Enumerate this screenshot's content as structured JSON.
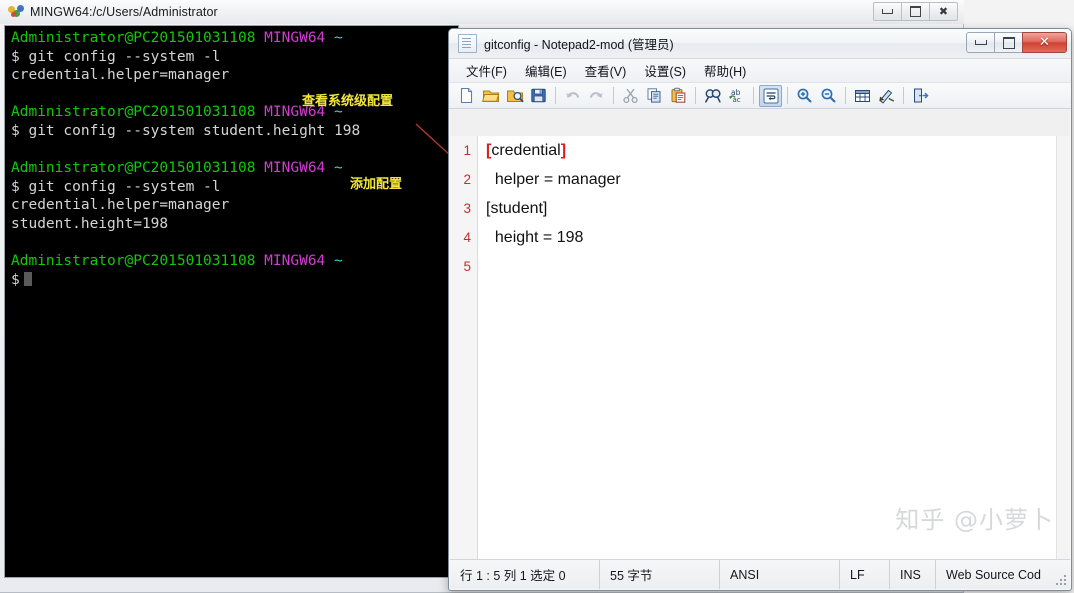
{
  "terminal": {
    "window_title": "MINGW64:/c/Users/Administrator",
    "icon": "mingw-bash-icon",
    "buttons": {
      "minimize": "minimize-icon",
      "maximize": "maximize-icon",
      "close": "close-icon"
    },
    "lines": [
      {
        "segments": [
          {
            "text": "Administrator@PC201501031108",
            "color": "green"
          },
          {
            "text": " ",
            "color": "white"
          },
          {
            "text": "MINGW64",
            "color": "magenta"
          },
          {
            "text": " ",
            "color": "white"
          },
          {
            "text": "~",
            "color": "cyan"
          }
        ]
      },
      {
        "segments": [
          {
            "text": "$ git config --system -l",
            "color": "white"
          }
        ]
      },
      {
        "segments": [
          {
            "text": "credential.helper=manager",
            "color": "white"
          }
        ]
      },
      {
        "segments": [
          {
            "text": "",
            "color": "white"
          }
        ]
      },
      {
        "segments": [
          {
            "text": "Administrator@PC201501031108",
            "color": "green"
          },
          {
            "text": " ",
            "color": "white"
          },
          {
            "text": "MINGW64",
            "color": "magenta"
          },
          {
            "text": " ",
            "color": "white"
          },
          {
            "text": "~",
            "color": "cyan"
          }
        ]
      },
      {
        "segments": [
          {
            "text": "$ git config --system student.height 198",
            "color": "white"
          }
        ]
      },
      {
        "segments": [
          {
            "text": "",
            "color": "white"
          }
        ]
      },
      {
        "segments": [
          {
            "text": "Administrator@PC201501031108",
            "color": "green"
          },
          {
            "text": " ",
            "color": "white"
          },
          {
            "text": "MINGW64",
            "color": "magenta"
          },
          {
            "text": " ",
            "color": "white"
          },
          {
            "text": "~",
            "color": "cyan"
          }
        ]
      },
      {
        "segments": [
          {
            "text": "$ git config --system -l",
            "color": "white"
          }
        ]
      },
      {
        "segments": [
          {
            "text": "credential.helper=manager",
            "color": "white"
          }
        ]
      },
      {
        "segments": [
          {
            "text": "student.height=198",
            "color": "white"
          }
        ]
      },
      {
        "segments": [
          {
            "text": "",
            "color": "white"
          }
        ]
      },
      {
        "segments": [
          {
            "text": "Administrator@PC201501031108",
            "color": "green"
          },
          {
            "text": " ",
            "color": "white"
          },
          {
            "text": "MINGW64",
            "color": "magenta"
          },
          {
            "text": " ",
            "color": "white"
          },
          {
            "text": "~",
            "color": "cyan"
          }
        ]
      },
      {
        "segments": [
          {
            "text": "$",
            "color": "white"
          }
        ],
        "cursor": true
      }
    ],
    "annotations": [
      {
        "text": "查看系统级配置",
        "color": "#f2e63c"
      },
      {
        "text": "添加配置",
        "color": "#f2e63c"
      }
    ],
    "arrow": {
      "color": "#c0392b",
      "from_label": "添加配置",
      "to_label": "[student] section"
    }
  },
  "notepad": {
    "title": "gitconfig - Notepad2-mod (管理员)",
    "app_icon": "notepad-document-icon",
    "window_buttons": {
      "minimize": "minimize-icon",
      "maximize": "maximize-icon",
      "close": "close-icon"
    },
    "menu": [
      {
        "label": "文件(F)",
        "name": "menu-file"
      },
      {
        "label": "编辑(E)",
        "name": "menu-edit"
      },
      {
        "label": "查看(V)",
        "name": "menu-view"
      },
      {
        "label": "设置(S)",
        "name": "menu-settings"
      },
      {
        "label": "帮助(H)",
        "name": "menu-help"
      }
    ],
    "toolbar": [
      {
        "icon": "new-file-icon",
        "sep_after": false
      },
      {
        "icon": "open-file-icon",
        "sep_after": false
      },
      {
        "icon": "browse-file-icon",
        "sep_after": false
      },
      {
        "icon": "save-icon",
        "sep_after": true
      },
      {
        "icon": "undo-icon",
        "sep_after": false
      },
      {
        "icon": "redo-icon",
        "sep_after": true
      },
      {
        "icon": "cut-icon",
        "sep_after": false
      },
      {
        "icon": "copy-icon",
        "sep_after": false
      },
      {
        "icon": "paste-icon",
        "sep_after": true
      },
      {
        "icon": "find-icon",
        "sep_after": false
      },
      {
        "icon": "replace-icon",
        "sep_after": true
      },
      {
        "icon": "word-wrap-icon",
        "pressed": true,
        "sep_after": true
      },
      {
        "icon": "zoom-in-icon",
        "sep_after": false
      },
      {
        "icon": "zoom-out-icon",
        "sep_after": true
      },
      {
        "icon": "show-whitespace-icon",
        "sep_after": false
      },
      {
        "icon": "scheme-icon",
        "sep_after": true
      },
      {
        "icon": "exit-icon",
        "sep_after": false
      }
    ],
    "editor": {
      "line_numbers": [
        "1",
        "2",
        "3",
        "4",
        "5"
      ],
      "lines": [
        {
          "pre": "",
          "bracket_open": "[",
          "name": "credential",
          "bracket_close": "]",
          "is_section": true,
          "text": "[credential]"
        },
        {
          "text": "  helper = manager",
          "is_section": false
        },
        {
          "text": "[student]",
          "is_section": false
        },
        {
          "text": "  height = 198",
          "is_section": false
        },
        {
          "text": "",
          "is_section": false
        }
      ]
    },
    "watermark": "知乎 @小萝卜",
    "status": {
      "position": "行 1 : 5   列 1   选定 0",
      "bytes": "55 字节",
      "encoding": "ANSI",
      "eol": "LF",
      "insert_mode": "INS",
      "lexer": "Web Source Cod"
    }
  }
}
